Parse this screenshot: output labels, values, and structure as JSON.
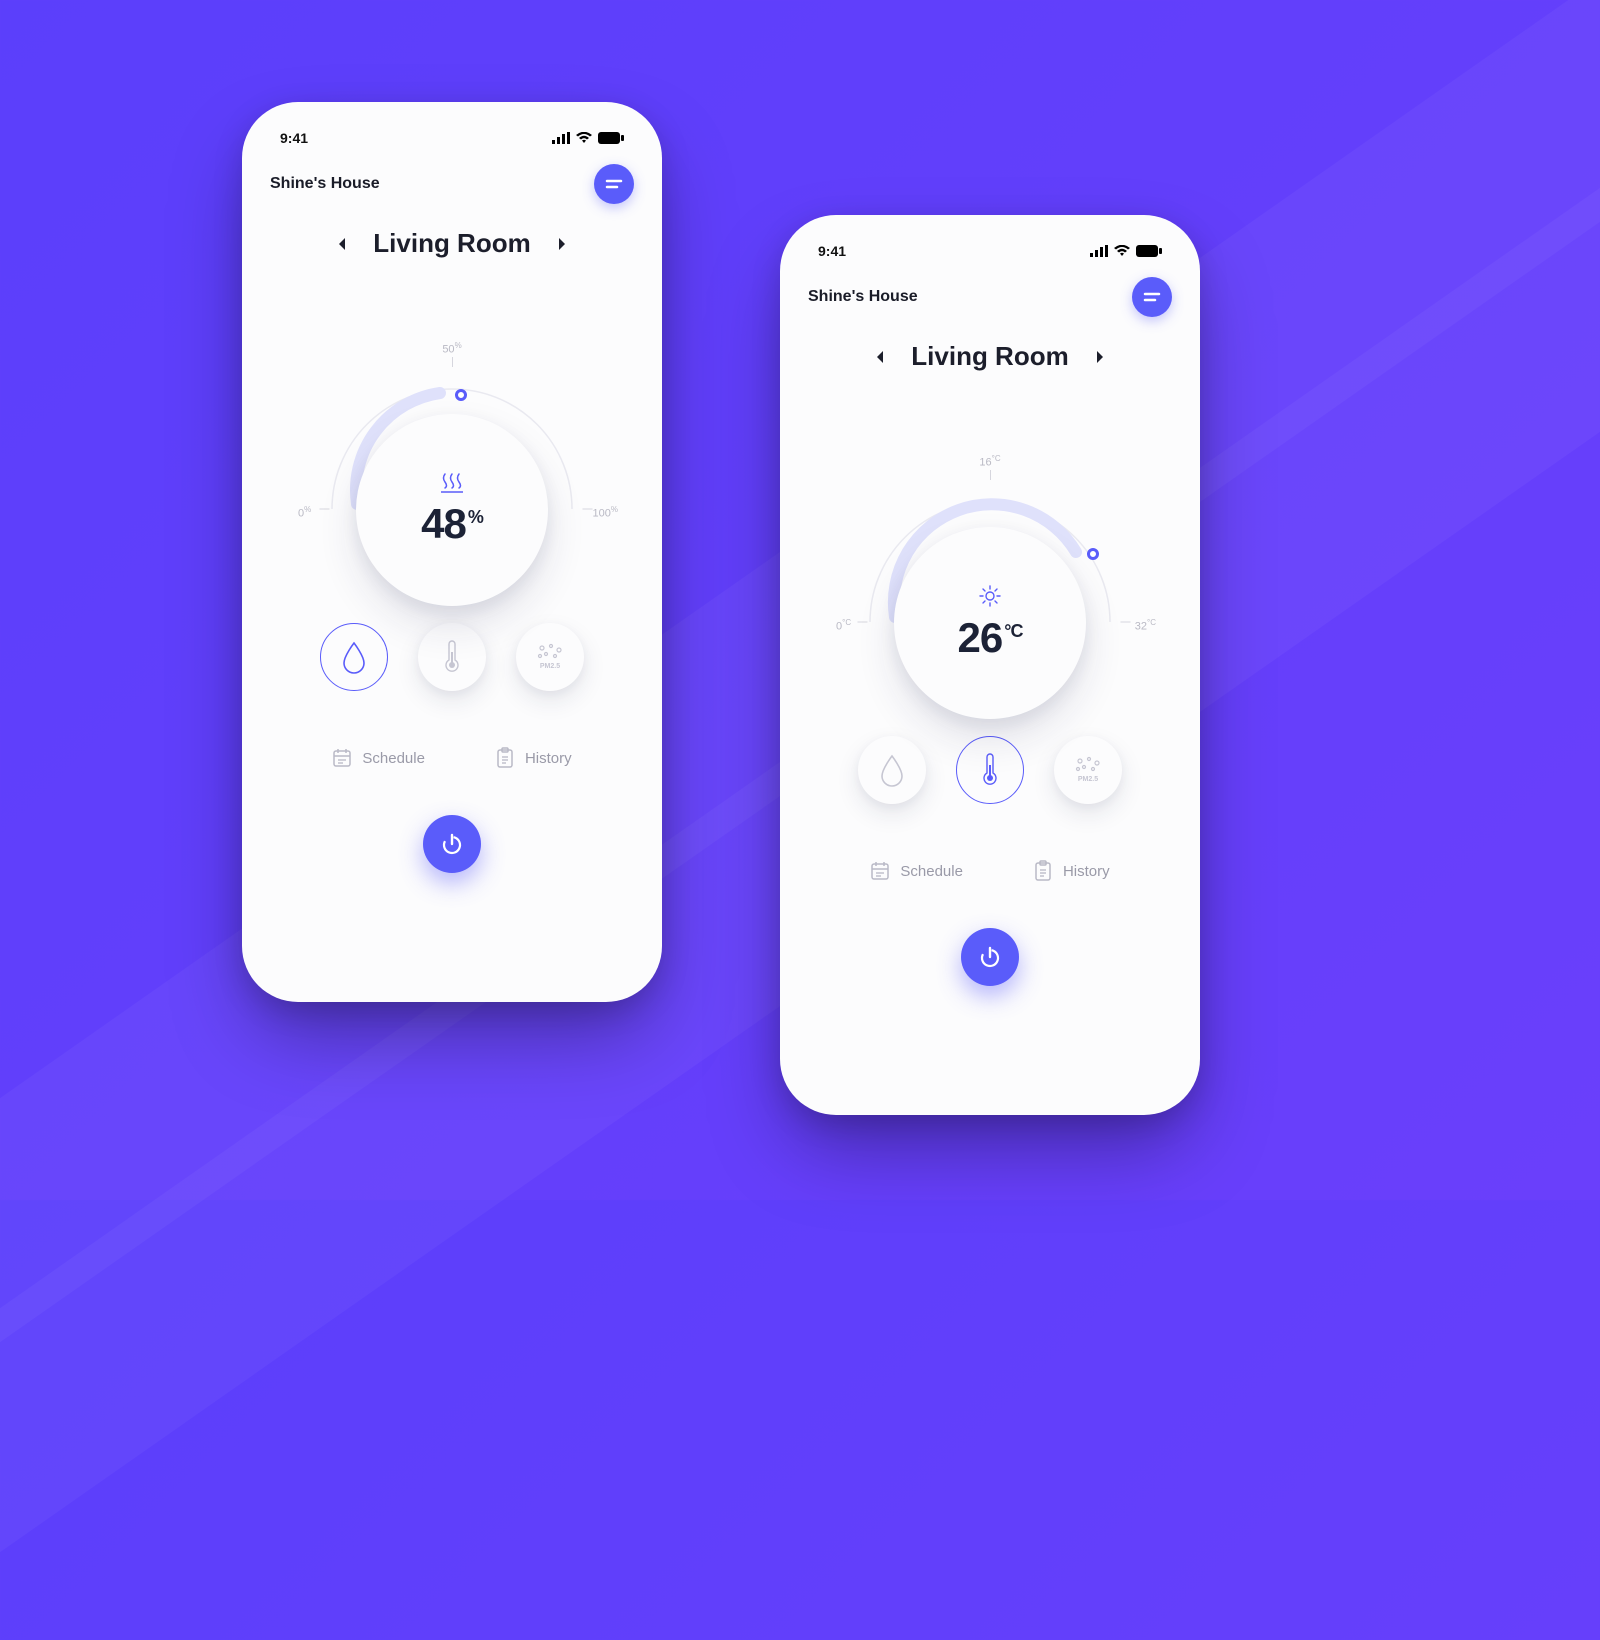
{
  "status_time": "9:41",
  "house_title": "Shine's House",
  "room_name": "Living Room",
  "footer": {
    "schedule": "Schedule",
    "history": "History"
  },
  "left": {
    "scale_min": "0",
    "scale_mid": "50",
    "scale_max": "100",
    "scale_unit": "%",
    "value": "48",
    "unit": "%",
    "indicator_angle": -95,
    "active_mode": "humidity"
  },
  "right": {
    "scale_min": "0",
    "scale_mid": "16",
    "scale_max": "32",
    "scale_unit": "°C",
    "value": "26",
    "unit": "°C",
    "indicator_angle": 55,
    "active_mode": "temperature"
  }
}
